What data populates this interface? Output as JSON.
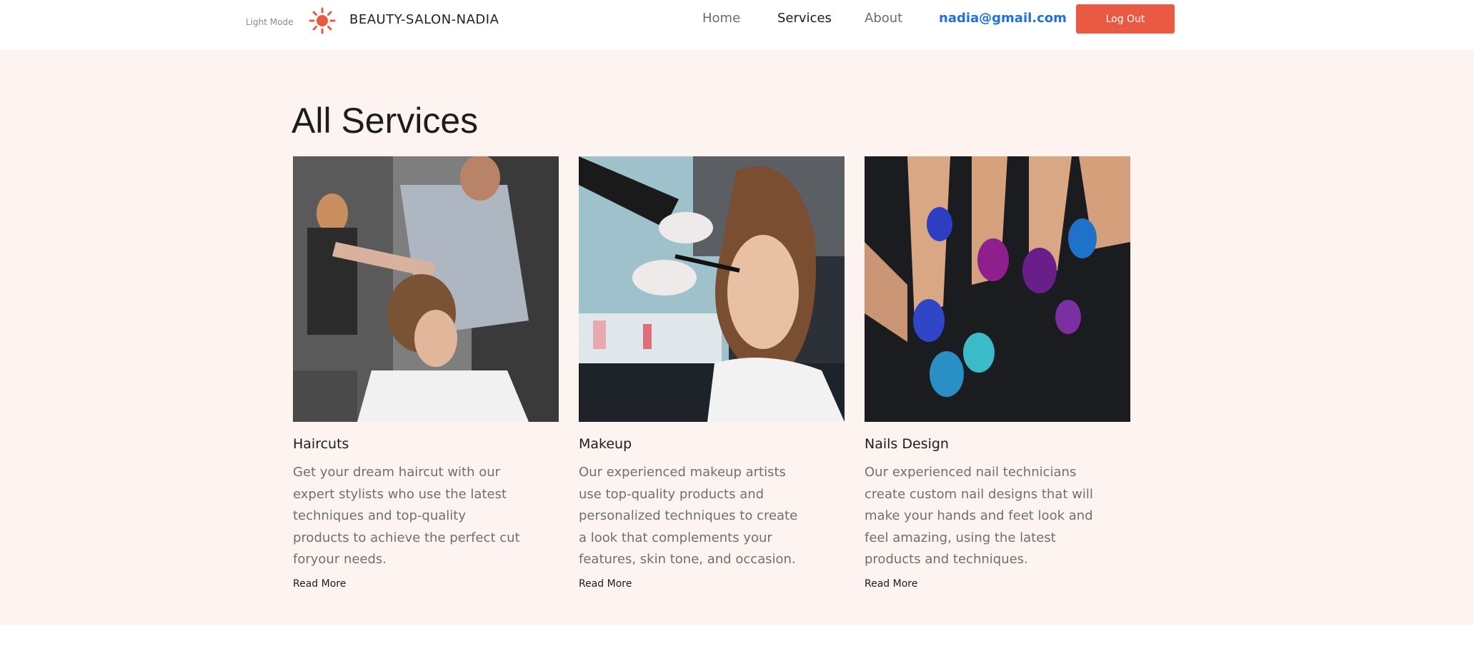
{
  "header": {
    "mode_label": "Light Mode",
    "mode_icon": "sun-icon",
    "brand": "BEAUTY-SALON-NADIA",
    "nav": {
      "home": "Home",
      "services": "Services",
      "about": "About",
      "email": "nadia@gmail.com"
    },
    "logout_label": "Log Out"
  },
  "main": {
    "title": "All Services",
    "services": [
      {
        "title": "Haircuts",
        "description": "Get your dream haircut with our expert stylists who use the latest techniques and top-quality products to achieve the perfect cut foryour needs.",
        "link": "Read More",
        "image": "haircut-photo"
      },
      {
        "title": "Makeup",
        "description": "Our experienced makeup artists use top-quality products and personalized techniques to create a look that complements your features, skin tone, and occasion.",
        "link": "Read More",
        "image": "makeup-photo"
      },
      {
        "title": "Nails Design",
        "description": "Our experienced nail technicians create custom nail designs that will make your hands and feet look and feel amazing, using the latest products and techniques.",
        "link": "Read More",
        "image": "nails-photo"
      }
    ]
  },
  "colors": {
    "accent": "#ea5a42",
    "email_link": "#1f6fe5",
    "main_background": "#fdf4f2"
  }
}
